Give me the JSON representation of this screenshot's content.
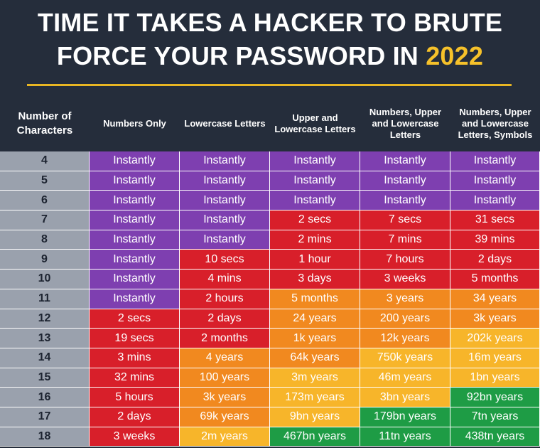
{
  "title": {
    "line1": "TIME IT TAKES A HACKER TO BRUTE",
    "line2_prefix": "FORCE YOUR PASSWORD IN ",
    "line2_year": "2022"
  },
  "colors": {
    "background": "#252d3b",
    "accent": "#f6c12a",
    "purple": "#7e3fb0",
    "red": "#d81f2a",
    "orange": "#f1891f",
    "yellow": "#f7b52a",
    "green": "#1e9c45",
    "number_column": "#9aa1ad"
  },
  "chart_data": {
    "type": "table",
    "columns": [
      "Number of Characters",
      "Numbers Only",
      "Lowercase Letters",
      "Upper and Lowercase Letters",
      "Numbers, Upper and Lowercase Letters",
      "Numbers, Upper and Lowercase Letters, Symbols"
    ],
    "rows": [
      {
        "chars": "4",
        "cells": [
          {
            "text": "Instantly",
            "color": "purple"
          },
          {
            "text": "Instantly",
            "color": "purple"
          },
          {
            "text": "Instantly",
            "color": "purple"
          },
          {
            "text": "Instantly",
            "color": "purple"
          },
          {
            "text": "Instantly",
            "color": "purple"
          }
        ]
      },
      {
        "chars": "5",
        "cells": [
          {
            "text": "Instantly",
            "color": "purple"
          },
          {
            "text": "Instantly",
            "color": "purple"
          },
          {
            "text": "Instantly",
            "color": "purple"
          },
          {
            "text": "Instantly",
            "color": "purple"
          },
          {
            "text": "Instantly",
            "color": "purple"
          }
        ]
      },
      {
        "chars": "6",
        "cells": [
          {
            "text": "Instantly",
            "color": "purple"
          },
          {
            "text": "Instantly",
            "color": "purple"
          },
          {
            "text": "Instantly",
            "color": "purple"
          },
          {
            "text": "Instantly",
            "color": "purple"
          },
          {
            "text": "Instantly",
            "color": "purple"
          }
        ]
      },
      {
        "chars": "7",
        "cells": [
          {
            "text": "Instantly",
            "color": "purple"
          },
          {
            "text": "Instantly",
            "color": "purple"
          },
          {
            "text": "2 secs",
            "color": "red"
          },
          {
            "text": "7 secs",
            "color": "red"
          },
          {
            "text": "31 secs",
            "color": "red"
          }
        ]
      },
      {
        "chars": "8",
        "cells": [
          {
            "text": "Instantly",
            "color": "purple"
          },
          {
            "text": "Instantly",
            "color": "purple"
          },
          {
            "text": "2 mins",
            "color": "red"
          },
          {
            "text": "7 mins",
            "color": "red"
          },
          {
            "text": "39 mins",
            "color": "red"
          }
        ]
      },
      {
        "chars": "9",
        "cells": [
          {
            "text": "Instantly",
            "color": "purple"
          },
          {
            "text": "10 secs",
            "color": "red"
          },
          {
            "text": "1 hour",
            "color": "red"
          },
          {
            "text": "7 hours",
            "color": "red"
          },
          {
            "text": "2 days",
            "color": "red"
          }
        ]
      },
      {
        "chars": "10",
        "cells": [
          {
            "text": "Instantly",
            "color": "purple"
          },
          {
            "text": "4 mins",
            "color": "red"
          },
          {
            "text": "3 days",
            "color": "red"
          },
          {
            "text": "3 weeks",
            "color": "red"
          },
          {
            "text": "5 months",
            "color": "red"
          }
        ]
      },
      {
        "chars": "11",
        "cells": [
          {
            "text": "Instantly",
            "color": "purple"
          },
          {
            "text": "2 hours",
            "color": "red"
          },
          {
            "text": "5 months",
            "color": "orange"
          },
          {
            "text": "3 years",
            "color": "orange"
          },
          {
            "text": "34 years",
            "color": "orange"
          }
        ]
      },
      {
        "chars": "12",
        "cells": [
          {
            "text": "2 secs",
            "color": "red"
          },
          {
            "text": "2 days",
            "color": "red"
          },
          {
            "text": "24 years",
            "color": "orange"
          },
          {
            "text": "200 years",
            "color": "orange"
          },
          {
            "text": "3k years",
            "color": "orange"
          }
        ]
      },
      {
        "chars": "13",
        "cells": [
          {
            "text": "19 secs",
            "color": "red"
          },
          {
            "text": "2 months",
            "color": "red"
          },
          {
            "text": "1k years",
            "color": "orange"
          },
          {
            "text": "12k years",
            "color": "orange"
          },
          {
            "text": "202k years",
            "color": "yellow"
          }
        ]
      },
      {
        "chars": "14",
        "cells": [
          {
            "text": "3 mins",
            "color": "red"
          },
          {
            "text": "4 years",
            "color": "orange"
          },
          {
            "text": "64k years",
            "color": "orange"
          },
          {
            "text": "750k years",
            "color": "yellow"
          },
          {
            "text": "16m years",
            "color": "yellow"
          }
        ]
      },
      {
        "chars": "15",
        "cells": [
          {
            "text": "32 mins",
            "color": "red"
          },
          {
            "text": "100 years",
            "color": "orange"
          },
          {
            "text": "3m years",
            "color": "yellow"
          },
          {
            "text": "46m years",
            "color": "yellow"
          },
          {
            "text": "1bn years",
            "color": "yellow"
          }
        ]
      },
      {
        "chars": "16",
        "cells": [
          {
            "text": "5 hours",
            "color": "red"
          },
          {
            "text": "3k years",
            "color": "orange"
          },
          {
            "text": "173m years",
            "color": "yellow"
          },
          {
            "text": "3bn years",
            "color": "yellow"
          },
          {
            "text": "92bn years",
            "color": "green"
          }
        ]
      },
      {
        "chars": "17",
        "cells": [
          {
            "text": "2 days",
            "color": "red"
          },
          {
            "text": "69k years",
            "color": "orange"
          },
          {
            "text": "9bn years",
            "color": "yellow"
          },
          {
            "text": "179bn years",
            "color": "green"
          },
          {
            "text": "7tn years",
            "color": "green"
          }
        ]
      },
      {
        "chars": "18",
        "cells": [
          {
            "text": "3 weeks",
            "color": "red"
          },
          {
            "text": "2m years",
            "color": "yellow"
          },
          {
            "text": "467bn years",
            "color": "green"
          },
          {
            "text": "11tn years",
            "color": "green"
          },
          {
            "text": "438tn years",
            "color": "green"
          }
        ]
      }
    ]
  }
}
